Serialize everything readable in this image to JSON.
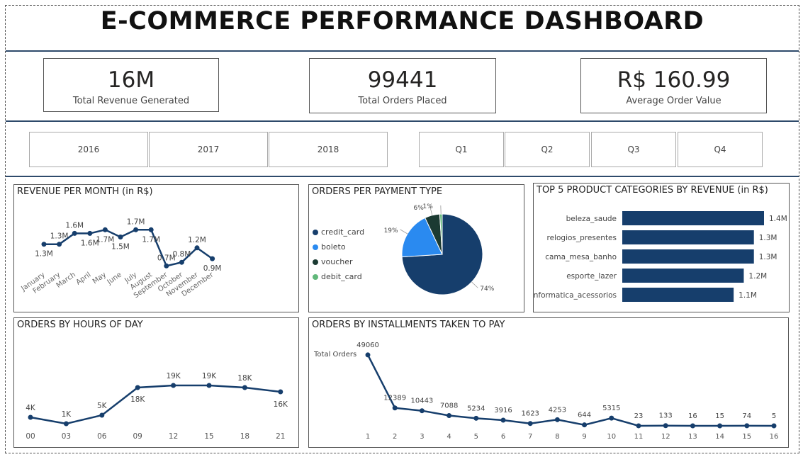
{
  "title": "E-COMMERCE PERFORMANCE DASHBOARD",
  "kpis": [
    {
      "value": "16M",
      "label": "Total Revenue Generated"
    },
    {
      "value": "99441",
      "label": "Total Orders Placed"
    },
    {
      "value": "R$ 160.99",
      "label": "Average Order Value"
    }
  ],
  "slicers": {
    "years": [
      "2016",
      "2017",
      "2018"
    ],
    "quarters": [
      "Q1",
      "Q2",
      "Q3",
      "Q4"
    ]
  },
  "colors": {
    "navy": "#163e6c",
    "blue": "#2a8af0",
    "darkgreen": "#1b3a32",
    "green": "#61b87a",
    "grid": "#e6e6e6"
  },
  "chart_data": [
    {
      "type": "line",
      "title": "REVENUE PER MONTH (in R$)",
      "categories": [
        "January",
        "February",
        "March",
        "April",
        "May",
        "June",
        "July",
        "August",
        "September",
        "October",
        "November",
        "December"
      ],
      "values": [
        1.3,
        1.3,
        1.6,
        1.6,
        1.7,
        1.5,
        1.7,
        1.7,
        0.7,
        0.8,
        1.2,
        0.9
      ],
      "labels": [
        "1.3M",
        "1.3M",
        "1.6M",
        "1.6M",
        "1.7M",
        "1.5M",
        "1.7M",
        "1.7M",
        "0.7M",
        "0.8M",
        "1.2M",
        "0.9M"
      ],
      "label_pos": [
        "below",
        "above",
        "above",
        "below",
        "below",
        "below",
        "above",
        "below",
        "above",
        "above",
        "above",
        "below"
      ]
    },
    {
      "type": "pie",
      "title": "ORDERS PER PAYMENT TYPE",
      "categories": [
        "credit_card",
        "boleto",
        "voucher",
        "debit_card"
      ],
      "values": [
        74,
        19,
        6,
        1
      ],
      "labels": [
        "74%",
        "19%",
        "6%",
        "1%"
      ]
    },
    {
      "type": "bar",
      "orientation": "horizontal",
      "title": "TOP 5 PRODUCT CATEGORIES BY REVENUE (in R$)",
      "categories": [
        "beleza_saude",
        "relogios_presentes",
        "cama_mesa_banho",
        "esporte_lazer",
        "informatica_acessorios"
      ],
      "values": [
        1.4,
        1.3,
        1.3,
        1.2,
        1.1
      ],
      "labels": [
        "1.4M",
        "1.3M",
        "1.3M",
        "1.2M",
        "1.1M"
      ]
    },
    {
      "type": "line",
      "title": "ORDERS BY HOURS OF DAY",
      "categories": [
        "00",
        "03",
        "06",
        "09",
        "12",
        "15",
        "18",
        "21"
      ],
      "values": [
        4,
        1,
        5,
        18,
        19,
        19,
        18,
        16
      ],
      "labels": [
        "4K",
        "1K",
        "5K",
        "18K",
        "19K",
        "19K",
        "18K",
        "16K"
      ]
    },
    {
      "type": "line",
      "title": "ORDERS BY INSTALLMENTS TAKEN TO PAY",
      "ylabel": "Total Orders",
      "categories": [
        "1",
        "2",
        "3",
        "4",
        "5",
        "6",
        "7",
        "8",
        "9",
        "10",
        "11",
        "12",
        "13",
        "14",
        "15",
        "16"
      ],
      "values": [
        49060,
        12389,
        10443,
        7088,
        5234,
        3916,
        1623,
        4253,
        644,
        5315,
        23,
        133,
        16,
        15,
        74,
        5
      ],
      "labels": [
        "49060",
        "12389",
        "10443",
        "7088",
        "5234",
        "3916",
        "1623",
        "4253",
        "644",
        "5315",
        "23",
        "133",
        "16",
        "15",
        "74",
        "5"
      ]
    }
  ]
}
